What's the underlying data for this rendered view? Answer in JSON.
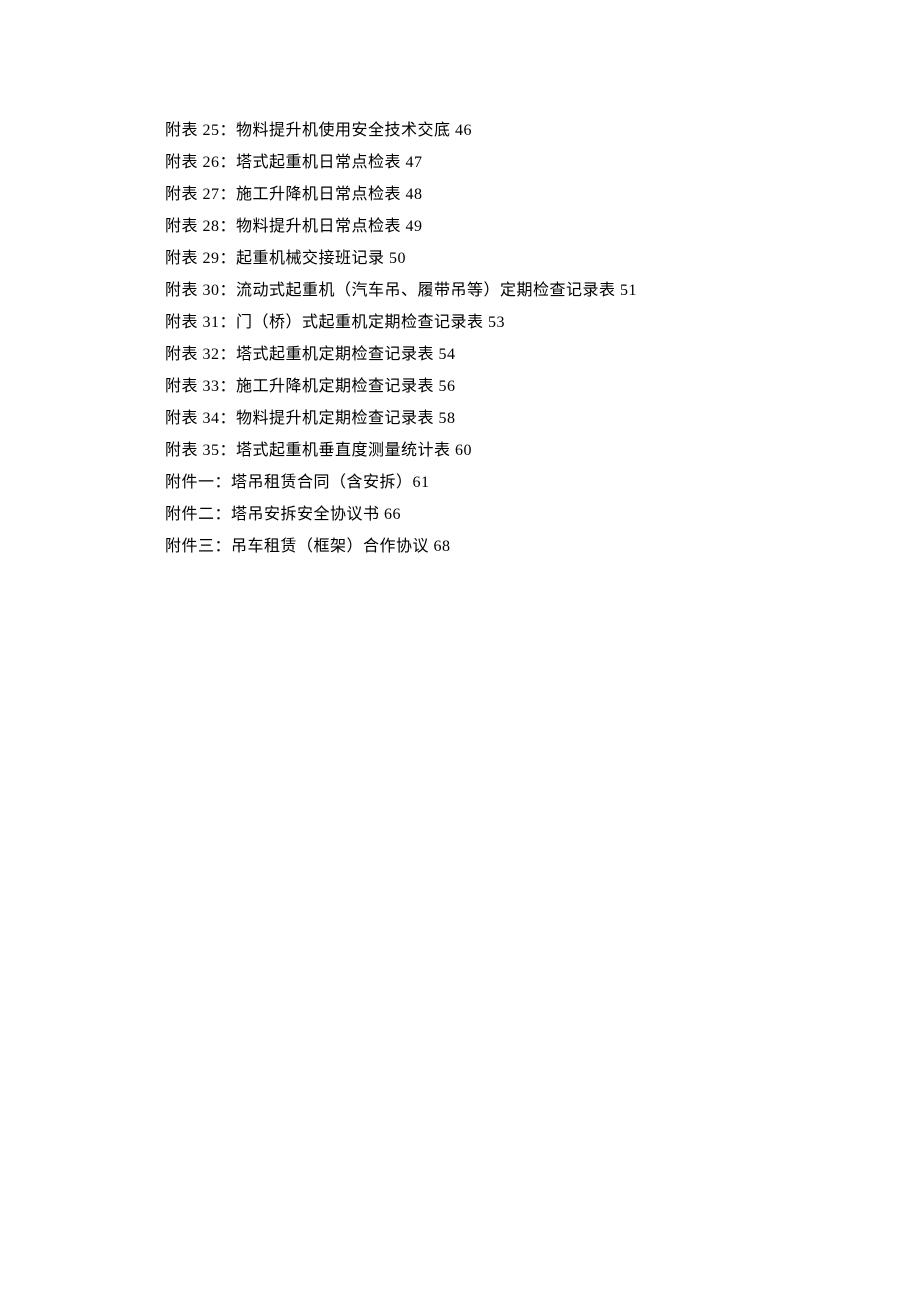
{
  "entries": [
    "附表 25：物料提升机使用安全技术交底 46",
    "附表 26：塔式起重机日常点检表 47",
    "附表 27：施工升降机日常点检表 48",
    "附表 28：物料提升机日常点检表 49",
    "附表 29：起重机械交接班记录 50",
    "附表 30：流动式起重机（汽车吊、履带吊等）定期检查记录表 51",
    "附表 31：门（桥）式起重机定期检查记录表 53",
    "附表 32：塔式起重机定期检查记录表 54",
    "附表 33：施工升降机定期检查记录表 56",
    "附表 34：物料提升机定期检查记录表 58",
    "附表 35：塔式起重机垂直度测量统计表 60",
    "附件一：塔吊租赁合同（含安拆）61",
    "附件二：塔吊安拆安全协议书 66",
    "附件三：吊车租赁（框架）合作协议 68"
  ]
}
